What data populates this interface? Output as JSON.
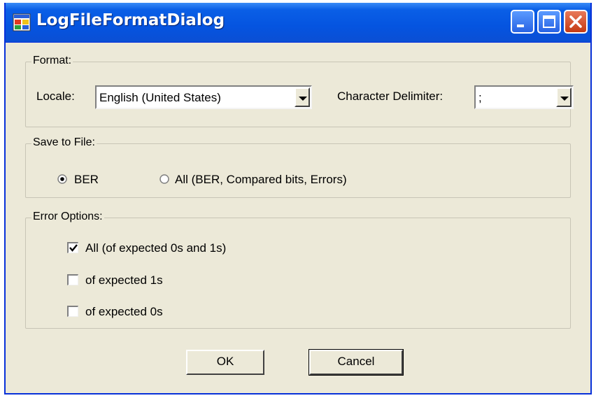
{
  "window": {
    "title": "LogFileFormatDialog",
    "colors": {
      "titlebar": "#0554e0",
      "face": "#ece9d8",
      "close": "#c53a12"
    }
  },
  "format": {
    "legend": "Format:",
    "locale_label": "Locale:",
    "locale_value": "English (United States)",
    "delimiter_label": "Character Delimiter:",
    "delimiter_value": ";"
  },
  "save_to_file": {
    "legend": "Save to File:",
    "options": [
      {
        "label": "BER",
        "selected": true
      },
      {
        "label": "All (BER, Compared bits, Errors)",
        "selected": false
      }
    ]
  },
  "error_options": {
    "legend": "Error Options:",
    "items": [
      {
        "label": "All (of expected 0s and 1s)",
        "checked": true
      },
      {
        "label": "of expected 1s",
        "checked": false
      },
      {
        "label": "of expected 0s",
        "checked": false
      }
    ]
  },
  "buttons": {
    "ok": "OK",
    "cancel": "Cancel"
  }
}
